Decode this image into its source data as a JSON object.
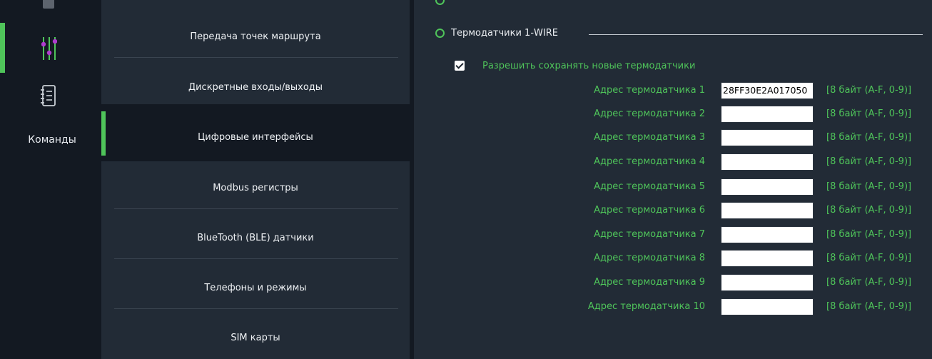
{
  "sidebar": {
    "commands_label": "Команды",
    "accent": "#4fc45a",
    "icons": [
      "settings-sliders-icon",
      "notebook-icon"
    ]
  },
  "menu": {
    "items": [
      {
        "label": "Передача точек маршрута"
      },
      {
        "label": "Дискретные входы/выходы"
      },
      {
        "label": "Цифровые интерфейсы",
        "selected": true
      },
      {
        "label": "Modbus регистры"
      },
      {
        "label": "BlueTooth (BLE) датчики"
      },
      {
        "label": "Телефоны и режимы"
      },
      {
        "label": "SIM карты"
      }
    ]
  },
  "content": {
    "section_title": "Термодатчики 1-WIRE",
    "allow_save_label": "Разрешить сохранять новые термодатчики",
    "allow_save_checked": true,
    "sensors": [
      {
        "label": "Адрес термодатчика 1",
        "value": "28FF30E2A017050",
        "hint": "[8 байт (A-F, 0-9)]"
      },
      {
        "label": "Адрес термодатчика 2",
        "value": "",
        "hint": "[8 байт (A-F, 0-9)]"
      },
      {
        "label": "Адрес термодатчика 3",
        "value": "",
        "hint": "[8 байт (A-F, 0-9)]"
      },
      {
        "label": "Адрес термодатчика 4",
        "value": "",
        "hint": "[8 байт (A-F, 0-9)]"
      },
      {
        "label": "Адрес термодатчика 5",
        "value": "",
        "hint": "[8 байт (A-F, 0-9)]"
      },
      {
        "label": "Адрес термодатчика 6",
        "value": "",
        "hint": "[8 байт (A-F, 0-9)]"
      },
      {
        "label": "Адрес термодатчика 7",
        "value": "",
        "hint": "[8 байт (A-F, 0-9)]"
      },
      {
        "label": "Адрес термодатчика 8",
        "value": "",
        "hint": "[8 байт (A-F, 0-9)]"
      },
      {
        "label": "Адрес термодатчика 9",
        "value": "",
        "hint": "[8 байт (A-F, 0-9)]"
      },
      {
        "label": "Адрес термодатчика 10",
        "value": "",
        "hint": "[8 байт (A-F, 0-9)]"
      }
    ]
  }
}
